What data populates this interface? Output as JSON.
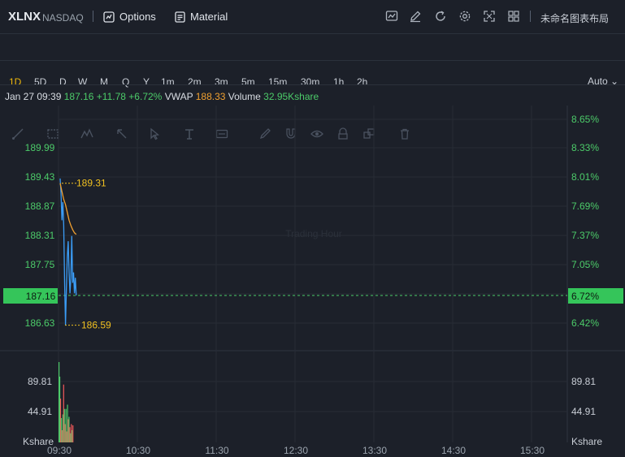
{
  "header": {
    "symbol": "XLNX",
    "exchange": "NASDAQ",
    "options_label": "Options",
    "material_label": "Material",
    "layout_label": "未命名图表布局"
  },
  "timeframes": [
    "1D",
    "5D",
    "D",
    "W",
    "M",
    "Q",
    "Y",
    "1m",
    "2m",
    "3m",
    "5m",
    "15m",
    "30m",
    "1h",
    "2h"
  ],
  "active_timeframe": "1D",
  "auto_label": "Auto",
  "info": {
    "date_time": "Jan 27 09:39",
    "price": "187.16",
    "change": "+11.78",
    "change_pct": "+6.72%",
    "vwap_label": "VWAP",
    "vwap_value": "188.33",
    "volume_label": "Volume",
    "volume_value": "32.95Kshare"
  },
  "watermark": "Trading Hour",
  "colors": {
    "up": "#4ccb69",
    "down": "#f45a5a",
    "price_line": "#3b9cf5",
    "vwap_line": "#f0a030",
    "annotation": "#f0c020",
    "active_tf": "#f0b90b"
  },
  "chart_data": {
    "type": "line",
    "x_ticks": [
      "09:30",
      "10:30",
      "11:30",
      "12:30",
      "13:30",
      "14:30",
      "15:30"
    ],
    "y_left_ticks": [
      "189.99",
      "189.43",
      "188.87",
      "188.31",
      "187.75",
      "187.16",
      "186.63"
    ],
    "y_right_ticks": [
      "8.65%",
      "8.33%",
      "8.01%",
      "7.69%",
      "7.37%",
      "7.05%",
      "6.72%",
      "6.42%"
    ],
    "ylim": [
      186.3,
      190.5
    ],
    "current_price": "187.16",
    "current_pct": "6.72%",
    "high_label": "189.31",
    "low_label": "186.59",
    "series": [
      {
        "name": "Price",
        "x": [
          0,
          0.5,
          1,
          1.5,
          2,
          2.5,
          3,
          3.5,
          4,
          4.5,
          5,
          5.5,
          6,
          6.5,
          7,
          7.5,
          8,
          8.5,
          9
        ],
        "values": [
          189.4,
          189.1,
          188.6,
          188.95,
          188.5,
          187.4,
          186.59,
          187.3,
          187.9,
          188.2,
          187.6,
          187.2,
          187.5,
          188.3,
          187.4,
          187.6,
          187.2,
          187.5,
          187.16
        ]
      },
      {
        "name": "VWAP",
        "x": [
          0,
          1,
          2,
          3,
          4,
          5,
          6,
          7,
          8,
          9
        ],
        "values": [
          189.31,
          189.15,
          189.0,
          188.9,
          188.75,
          188.6,
          188.5,
          188.42,
          188.36,
          188.33
        ]
      }
    ],
    "volume": {
      "ticks": [
        "89.81",
        "44.91"
      ],
      "unit": "Kshare",
      "max": 140,
      "values": [
        132,
        108,
        72,
        40,
        20,
        46,
        95,
        55,
        30,
        55,
        18,
        62,
        38,
        42,
        25,
        15,
        30,
        20,
        28
      ],
      "up": [
        true,
        true,
        false,
        true,
        false,
        true,
        false,
        true,
        false,
        true,
        false,
        true,
        false,
        true,
        false,
        true,
        false,
        true,
        false
      ]
    }
  }
}
